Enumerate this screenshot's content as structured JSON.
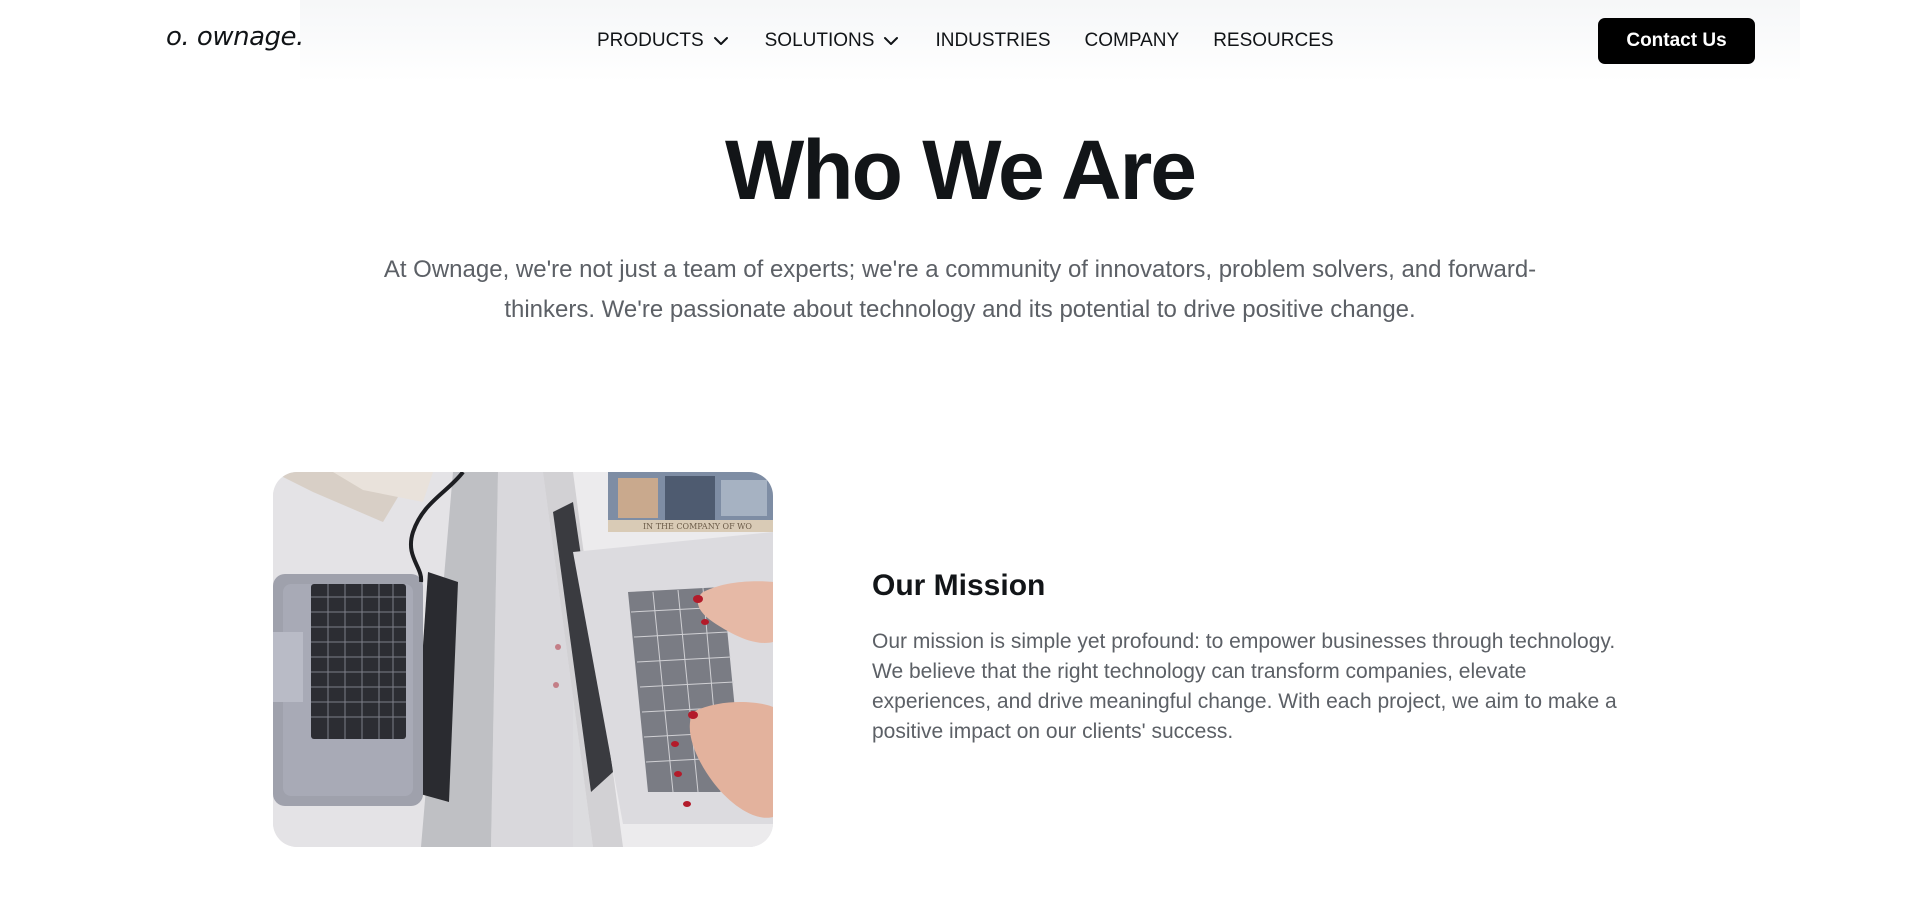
{
  "brand": {
    "logo_text": "o. ownage."
  },
  "nav": {
    "items": [
      {
        "label": "PRODUCTS",
        "has_dropdown": true
      },
      {
        "label": "SOLUTIONS",
        "has_dropdown": true
      },
      {
        "label": "INDUSTRIES",
        "has_dropdown": false
      },
      {
        "label": "COMPANY",
        "has_dropdown": false
      },
      {
        "label": "RESOURCES",
        "has_dropdown": false
      }
    ],
    "dropdown_icon": "chevron-down-icon"
  },
  "header": {
    "cta_label": "Contact Us"
  },
  "hero": {
    "title": "Who We Are",
    "description": "At Ownage, we're not just a team of experts; we're a community of innovators, problem solvers, and forward-thinkers. We're passionate about technology and its potential to drive positive change."
  },
  "mission": {
    "image_label": "IN THE COMPANY OF WO",
    "title": "Our Mission",
    "body": "Our mission is simple yet profound: to empower businesses through technology. We believe that the right technology can transform companies, elevate experiences, and drive meaningful change. With each project, we aim to make a positive impact on our clients' success."
  },
  "colors": {
    "text_dark": "#121518",
    "text_muted": "#5c6066",
    "cta_background": "#000000",
    "cta_text": "#ffffff",
    "page_background": "#ffffff"
  }
}
